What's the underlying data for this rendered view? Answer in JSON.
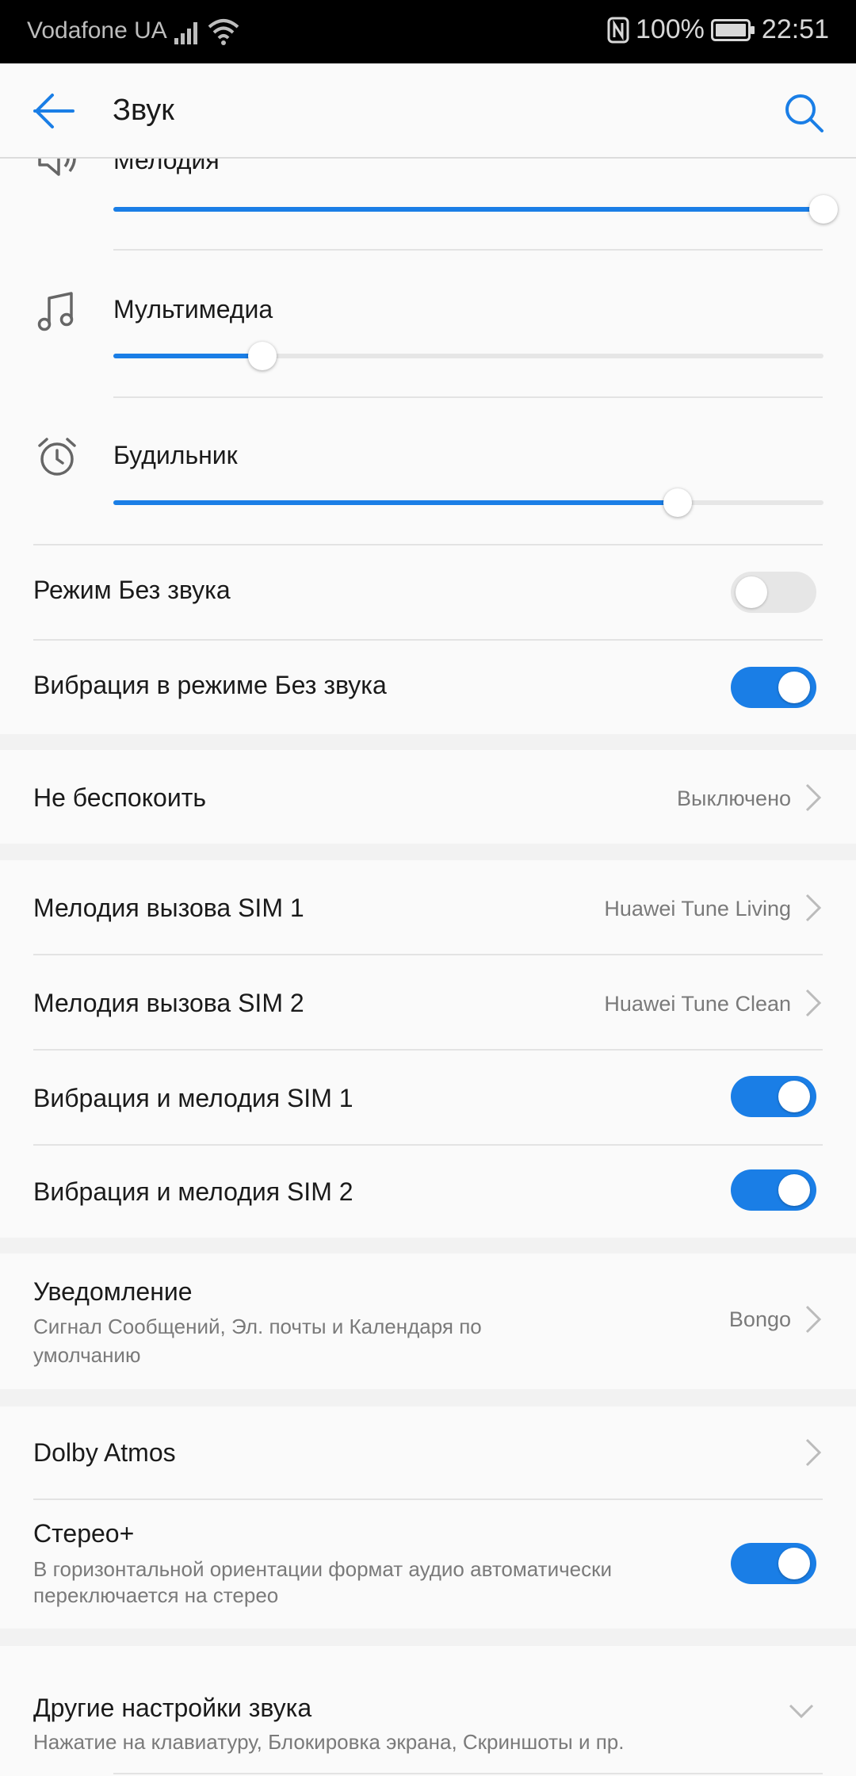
{
  "status": {
    "carrier": "Vodafone UA",
    "battery": "100%",
    "time": "22:51"
  },
  "header": {
    "title": "Звук"
  },
  "volume": {
    "ringtone": {
      "label": "Мелодия",
      "level": 1.0
    },
    "media": {
      "label": "Мультимедиа",
      "level": 0.21
    },
    "alarm": {
      "label": "Будильник",
      "level": 0.795
    }
  },
  "silent_mode": {
    "label": "Режим Без звука",
    "on": false
  },
  "vibrate_silent": {
    "label": "Вибрация в режиме Без звука",
    "on": true
  },
  "dnd": {
    "label": "Не беспокоить",
    "value": "Выключено"
  },
  "ringtone_sim1": {
    "label": "Мелодия вызова SIM 1",
    "value": "Huawei Tune Living"
  },
  "ringtone_sim2": {
    "label": "Мелодия вызова SIM 2",
    "value": "Huawei Tune Clean"
  },
  "vibrate_sim1": {
    "label": "Вибрация и мелодия SIM 1",
    "on": true
  },
  "vibrate_sim2": {
    "label": "Вибрация и мелодия SIM 2",
    "on": true
  },
  "notification": {
    "label": "Уведомление",
    "subtitle_line1": "Сигнал Сообщений, Эл. почты и Календаря по",
    "subtitle_line2": "умолчанию",
    "value": "Bongo"
  },
  "dolby": {
    "label": "Dolby Atmos"
  },
  "stereo": {
    "label": "Стерео+",
    "subtitle_line1": "В горизонтальной ориентации формат аудио автоматически",
    "subtitle_line2": "переключается на стерео",
    "on": true
  },
  "other": {
    "label": "Другие настройки звука",
    "subtitle": "Нажатие на клавиатуру, Блокировка экрана, Скриншоты и пр."
  },
  "colors": {
    "accent": "#1a7ee6",
    "background": "#fafafa",
    "separator": "#f2f2f2"
  }
}
